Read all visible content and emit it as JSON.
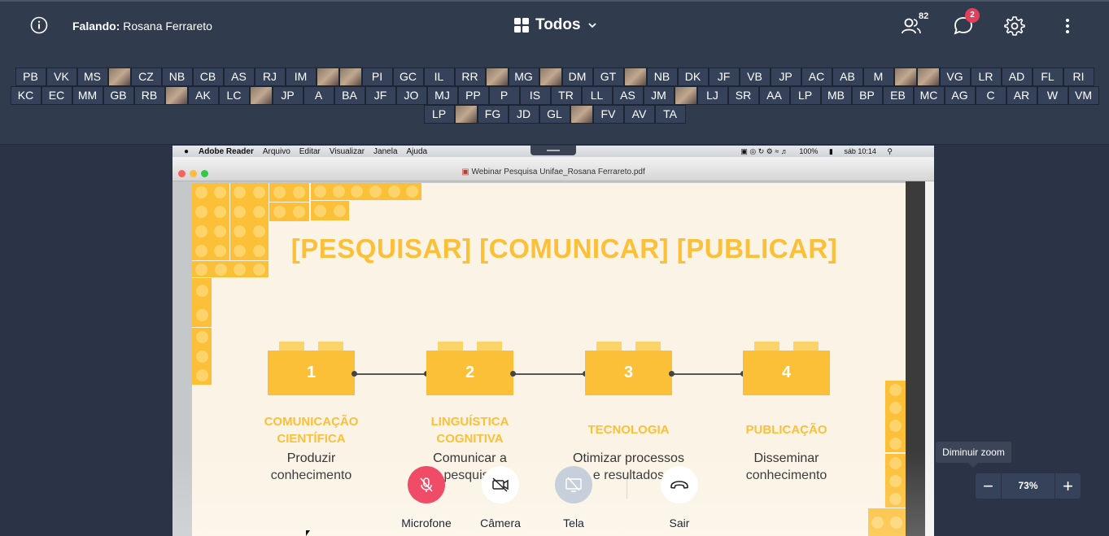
{
  "header": {
    "speaker_prefix": "Falando:",
    "speaker_name": "Rosana Ferrareto",
    "layout_label": "Todos",
    "participants_count": "82",
    "chat_badge": "2"
  },
  "participants": {
    "row1": [
      {
        "label": "PB"
      },
      {
        "label": "VK"
      },
      {
        "label": "MS"
      },
      {
        "label": "",
        "photo": true
      },
      {
        "label": "CZ"
      },
      {
        "label": "NB"
      },
      {
        "label": "CB"
      },
      {
        "label": "AS"
      },
      {
        "label": "RJ"
      },
      {
        "label": "IM"
      },
      {
        "label": "",
        "photo": true
      },
      {
        "label": "",
        "photo": true
      },
      {
        "label": "PI"
      },
      {
        "label": "GC"
      },
      {
        "label": "IL"
      },
      {
        "label": "RR"
      },
      {
        "label": "",
        "photo": true
      },
      {
        "label": "MG"
      },
      {
        "label": "",
        "photo": true
      },
      {
        "label": "DM"
      },
      {
        "label": "GT"
      },
      {
        "label": "",
        "photo": true
      },
      {
        "label": "NB"
      },
      {
        "label": "DK"
      },
      {
        "label": "JF"
      },
      {
        "label": "VB"
      },
      {
        "label": "JP"
      },
      {
        "label": "AC"
      },
      {
        "label": "AB"
      },
      {
        "label": "M"
      },
      {
        "label": "",
        "photo": true
      },
      {
        "label": "",
        "photo": true
      },
      {
        "label": "VG"
      },
      {
        "label": "LR"
      },
      {
        "label": "AD"
      },
      {
        "label": "FL"
      },
      {
        "label": "RI"
      }
    ],
    "row2": [
      {
        "label": "KC"
      },
      {
        "label": "EC"
      },
      {
        "label": "MM"
      },
      {
        "label": "GB"
      },
      {
        "label": "RB"
      },
      {
        "label": "",
        "photo": true
      },
      {
        "label": "AK"
      },
      {
        "label": "LC"
      },
      {
        "label": "",
        "photo": true
      },
      {
        "label": "JP"
      },
      {
        "label": "A"
      },
      {
        "label": "BA"
      },
      {
        "label": "JF"
      },
      {
        "label": "JO"
      },
      {
        "label": "MJ"
      },
      {
        "label": "PP"
      },
      {
        "label": "P"
      },
      {
        "label": "IS"
      },
      {
        "label": "TR"
      },
      {
        "label": "LL"
      },
      {
        "label": "AS"
      },
      {
        "label": "JM"
      },
      {
        "label": "",
        "photo": true
      },
      {
        "label": "LJ"
      },
      {
        "label": "SR"
      },
      {
        "label": "AA"
      },
      {
        "label": "LP"
      },
      {
        "label": "MB"
      },
      {
        "label": "BP"
      },
      {
        "label": "EB"
      },
      {
        "label": "MC"
      },
      {
        "label": "AG"
      },
      {
        "label": "C"
      },
      {
        "label": "AR"
      },
      {
        "label": "W"
      },
      {
        "label": "VM"
      }
    ],
    "row3": [
      {
        "label": "LP"
      },
      {
        "label": "",
        "photo": true
      },
      {
        "label": "FG"
      },
      {
        "label": "JD"
      },
      {
        "label": "GL"
      },
      {
        "label": "",
        "photo": true
      },
      {
        "label": "FV"
      },
      {
        "label": "AV"
      },
      {
        "label": "TA"
      }
    ]
  },
  "mac_menu": {
    "app": "Adobe Reader",
    "items": [
      "Arquivo",
      "Editar",
      "Visualizar",
      "Janela",
      "Ajuda"
    ],
    "battery": "100%",
    "clock": "sáb 10:14"
  },
  "window": {
    "title": "Webinar Pesquisa Unifae_Rosana Ferrareto.pdf"
  },
  "slide": {
    "title": "[PESQUISAR] [COMUNICAR] [PUBLICAR]",
    "steps": [
      {
        "num": "1",
        "title_l1": "COMUNICAÇÃO",
        "title_l2": "CIENTÍFICA",
        "desc_l1": "Produzir",
        "desc_l2": "conhecimento"
      },
      {
        "num": "2",
        "title_l1": "LINGUÍSTICA",
        "title_l2": "COGNITIVA",
        "desc_l1": "Comunicar a",
        "desc_l2": "pesquisa"
      },
      {
        "num": "3",
        "title_l1": "TECNOLOGIA",
        "title_l2": "",
        "desc_l1": "Otimizar processos",
        "desc_l2": "e resultados"
      },
      {
        "num": "4",
        "title_l1": "PUBLICAÇÃO",
        "title_l2": "",
        "desc_l1": "Disseminar",
        "desc_l2": "conhecimento"
      }
    ],
    "accent_color": "#fcbf38"
  },
  "controls": {
    "mic": "Microfone",
    "camera": "Câmera",
    "screen": "Tela",
    "leave": "Sair"
  },
  "zoom": {
    "tooltip": "Diminuir zoom",
    "value": "73%",
    "minus": "−",
    "plus": "+"
  }
}
